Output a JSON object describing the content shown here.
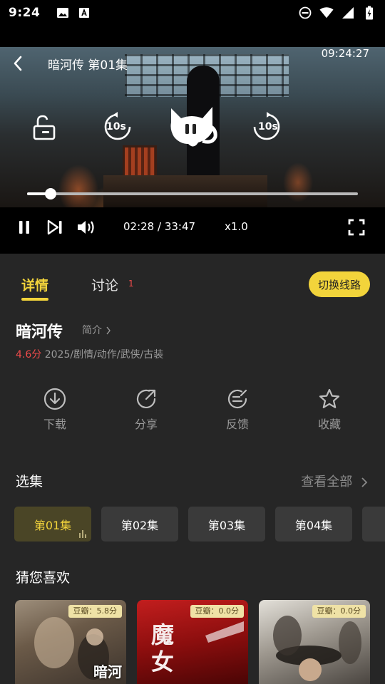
{
  "status_bar": {
    "time": "9:24"
  },
  "player": {
    "title": "暗河传 第01集",
    "clock": "09:24:27",
    "rewind_label": "10s",
    "forward_label": "10s",
    "progress": 0.072,
    "time_display": "02:28 / 33:47",
    "speed": "x1.0"
  },
  "tabs": [
    {
      "label": "详情"
    },
    {
      "label": "讨论",
      "badge": "1"
    }
  ],
  "switch_line_label": "切换线路",
  "show": {
    "title": "暗河传",
    "intro_label": "简介",
    "rating": "4.6分",
    "meta": "2025/剧情/动作/武侠/古装"
  },
  "actions": [
    {
      "label": "下载",
      "icon": "download-icon"
    },
    {
      "label": "分享",
      "icon": "share-icon"
    },
    {
      "label": "反馈",
      "icon": "feedback-icon"
    },
    {
      "label": "收藏",
      "icon": "star-icon"
    }
  ],
  "episodes_section": {
    "title": "选集",
    "view_all": "查看全部",
    "episodes": [
      "第01集",
      "第02集",
      "第03集",
      "第04集"
    ]
  },
  "recommend_section": {
    "title": "猜您喜欢",
    "posters": [
      {
        "badge": "豆瓣：5.8分",
        "art_text": "暗河"
      },
      {
        "badge": "豆瓣：0.0分",
        "art_text": "魔女"
      },
      {
        "badge": "豆瓣：0.0分"
      }
    ]
  },
  "colors": {
    "accent": "#f2d43b",
    "rating": "#ef4b4b",
    "background": "#262626"
  }
}
